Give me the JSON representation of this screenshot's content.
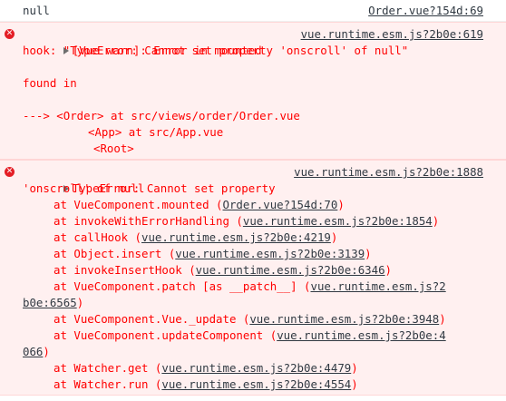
{
  "log": {
    "text": "null",
    "source": "Order.vue?154d:69"
  },
  "warn": {
    "line1": "[Vue warn]: Error in mounted",
    "source": "vue.runtime.esm.js?2b0e:619",
    "line2": "hook: \"TypeError: Cannot set property 'onscroll' of null\"",
    "found": "found in",
    "tree1_prefix": "---> <Order> at ",
    "tree1_path": "src/views/order/Order.vue",
    "tree2": "<App> at src/App.vue",
    "tree3": "<Root>"
  },
  "error": {
    "line1": "TypeError: Cannot set property",
    "source": "vue.runtime.esm.js?2b0e:1888",
    "line2": "'onscroll' of null",
    "frames": [
      {
        "pre": "at VueComponent.mounted (",
        "link": "Order.vue?154d:70",
        "post": ")"
      },
      {
        "pre": "at invokeWithErrorHandling (",
        "link": "vue.runtime.esm.js?2b0e:1854",
        "post": ")"
      },
      {
        "pre": "at callHook (",
        "link": "vue.runtime.esm.js?2b0e:4219",
        "post": ")"
      },
      {
        "pre": "at Object.insert (",
        "link": "vue.runtime.esm.js?2b0e:3139",
        "post": ")"
      },
      {
        "pre": "at invokeInsertHook (",
        "link": "vue.runtime.esm.js?2b0e:6346",
        "post": ")"
      },
      {
        "pre": "at VueComponent.patch [as __patch__] (",
        "link": "vue.runtime.esm.js?2",
        "link2": "b0e:6565",
        "post": ")"
      },
      {
        "pre": "at VueComponent.Vue._update (",
        "link": "vue.runtime.esm.js?2b0e:3948",
        "post": ")"
      },
      {
        "pre": "at VueComponent.updateComponent (",
        "link": "vue.runtime.esm.js?2b0e:4",
        "link2": "066",
        "post": ")"
      },
      {
        "pre": "at Watcher.get (",
        "link": "vue.runtime.esm.js?2b0e:4479",
        "post": ")"
      },
      {
        "pre": "at Watcher.run (",
        "link": "vue.runtime.esm.js?2b0e:4554",
        "post": ")"
      }
    ]
  },
  "icons": {
    "error": "error-circle-icon",
    "expand": "expand-triangle-icon"
  },
  "colors": {
    "error_text": "#ff0000",
    "error_bg": "#fff0f0",
    "link": "#303942",
    "icon_red": "#e41e26"
  }
}
